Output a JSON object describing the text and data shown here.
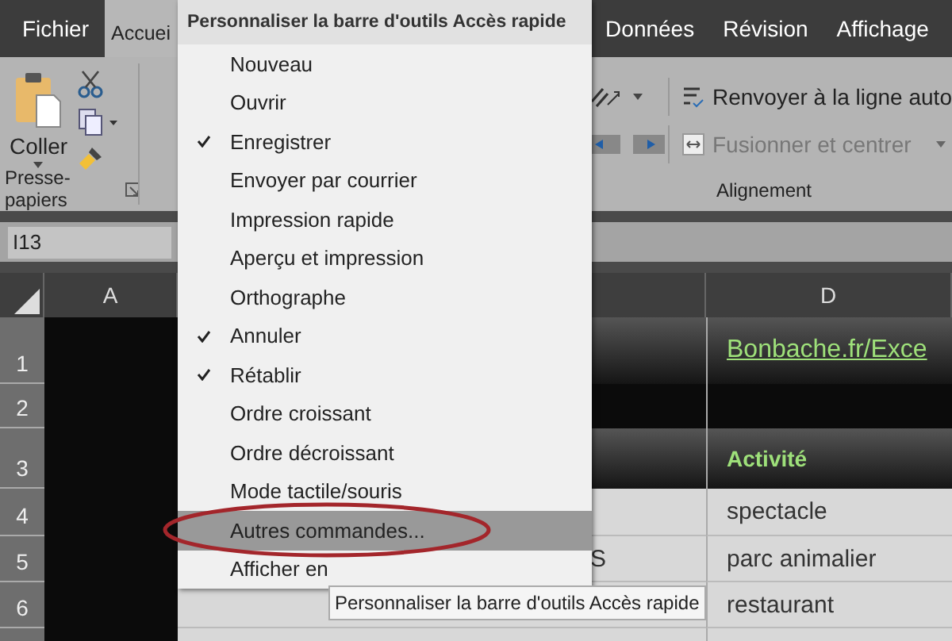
{
  "tabs": [
    {
      "label": "Fichier",
      "selected": false
    },
    {
      "label": "Accuei",
      "selected": true
    },
    {
      "label": "Données",
      "selected": false
    },
    {
      "label": "Révision",
      "selected": false
    },
    {
      "label": "Affichage",
      "selected": false
    }
  ],
  "clipboard": {
    "paste_label": "Coller",
    "group_label": "Presse-papiers"
  },
  "alignment": {
    "wrap_label": "Renvoyer à la ligne auto",
    "merge_label": "Fusionner et centrer",
    "merge_disabled": true,
    "group_label": "Alignement"
  },
  "name_box": {
    "value": "I13"
  },
  "columns": [
    {
      "label": "A"
    },
    {
      "label": "D"
    }
  ],
  "rows": [
    {
      "header": "1",
      "kind": "title",
      "column_c": "",
      "column_d": "Bonbache.fr/Exce"
    },
    {
      "header": "2",
      "kind": "blank",
      "column_c": "",
      "column_d": ""
    },
    {
      "header": "3",
      "kind": "heading",
      "column_c": "",
      "column_d": "Activité"
    },
    {
      "header": "4",
      "kind": "data",
      "column_c": "",
      "column_d": "spectacle"
    },
    {
      "header": "5",
      "kind": "data",
      "column_c": "S",
      "column_d": "parc animalier"
    },
    {
      "header": "6",
      "kind": "data",
      "column_c": "",
      "column_d": "restaurant"
    }
  ],
  "menu": {
    "title": "Personnaliser la barre d'outils Accès rapide",
    "items": [
      {
        "label": "Nouveau",
        "checked": false,
        "selected": false
      },
      {
        "label": "Ouvrir",
        "checked": false,
        "selected": false
      },
      {
        "label": "Enregistrer",
        "checked": true,
        "selected": false
      },
      {
        "label": "Envoyer par courrier",
        "checked": false,
        "selected": false
      },
      {
        "label": "Impression rapide",
        "checked": false,
        "selected": false
      },
      {
        "label": "Aperçu et impression",
        "checked": false,
        "selected": false
      },
      {
        "label": "Orthographe",
        "checked": false,
        "selected": false
      },
      {
        "label": "Annuler",
        "checked": true,
        "selected": false
      },
      {
        "label": "Rétablir",
        "checked": true,
        "selected": false
      },
      {
        "label": "Ordre croissant",
        "checked": false,
        "selected": false
      },
      {
        "label": "Ordre décroissant",
        "checked": false,
        "selected": false
      },
      {
        "label": "Mode tactile/souris",
        "checked": false,
        "selected": false
      },
      {
        "label": "Autres commandes...",
        "checked": false,
        "selected": true
      },
      {
        "label": "Afficher en",
        "checked": false,
        "selected": false
      }
    ]
  },
  "tooltip": {
    "text": "Personnaliser la barre d'outils Accès rapide"
  }
}
